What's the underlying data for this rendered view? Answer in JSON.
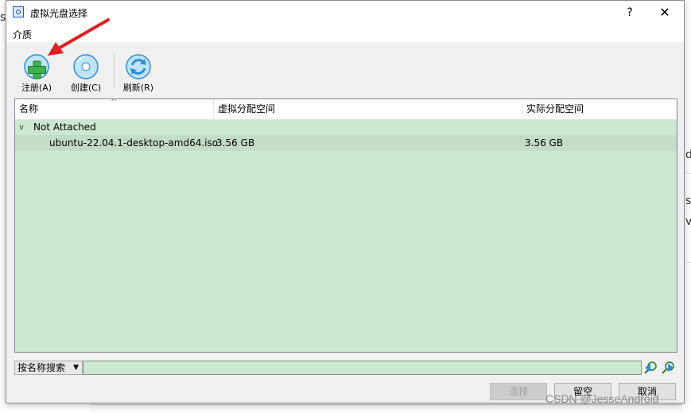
{
  "background": {
    "left_letter": "s",
    "right_letters": [
      "d",
      "s",
      "v"
    ]
  },
  "window": {
    "title": "虚拟光盘选择",
    "help": "?",
    "close": "✕"
  },
  "menu": {
    "media_label": "介质"
  },
  "toolbar": {
    "register_label": "注册(A)",
    "create_label": "创建(C)",
    "refresh_label": "刷新(R)"
  },
  "list": {
    "columns": [
      "名称",
      "虚拟分配空间",
      "实际分配空间"
    ],
    "sort_indicator": "^",
    "group": {
      "chevron": "v",
      "label": "Not Attached"
    },
    "rows": [
      {
        "name": "ubuntu-22.04.1-desktop-amd64.iso",
        "virtual_size": "3.56 GB",
        "actual_size": "3.56 GB"
      }
    ]
  },
  "search": {
    "mode_label": "按名称搜索",
    "dropdown_arrow": "▼",
    "value": ""
  },
  "buttons": {
    "select_label": "选择",
    "leave_empty_label": "留空",
    "cancel_label": "取消"
  },
  "watermark": "CSDN @JesseAndroid",
  "colors": {
    "list_bg": "#cde8d0",
    "arrow": "#e02020",
    "icon_green": "#3cb44a",
    "icon_blue": "#2a8fd8"
  }
}
